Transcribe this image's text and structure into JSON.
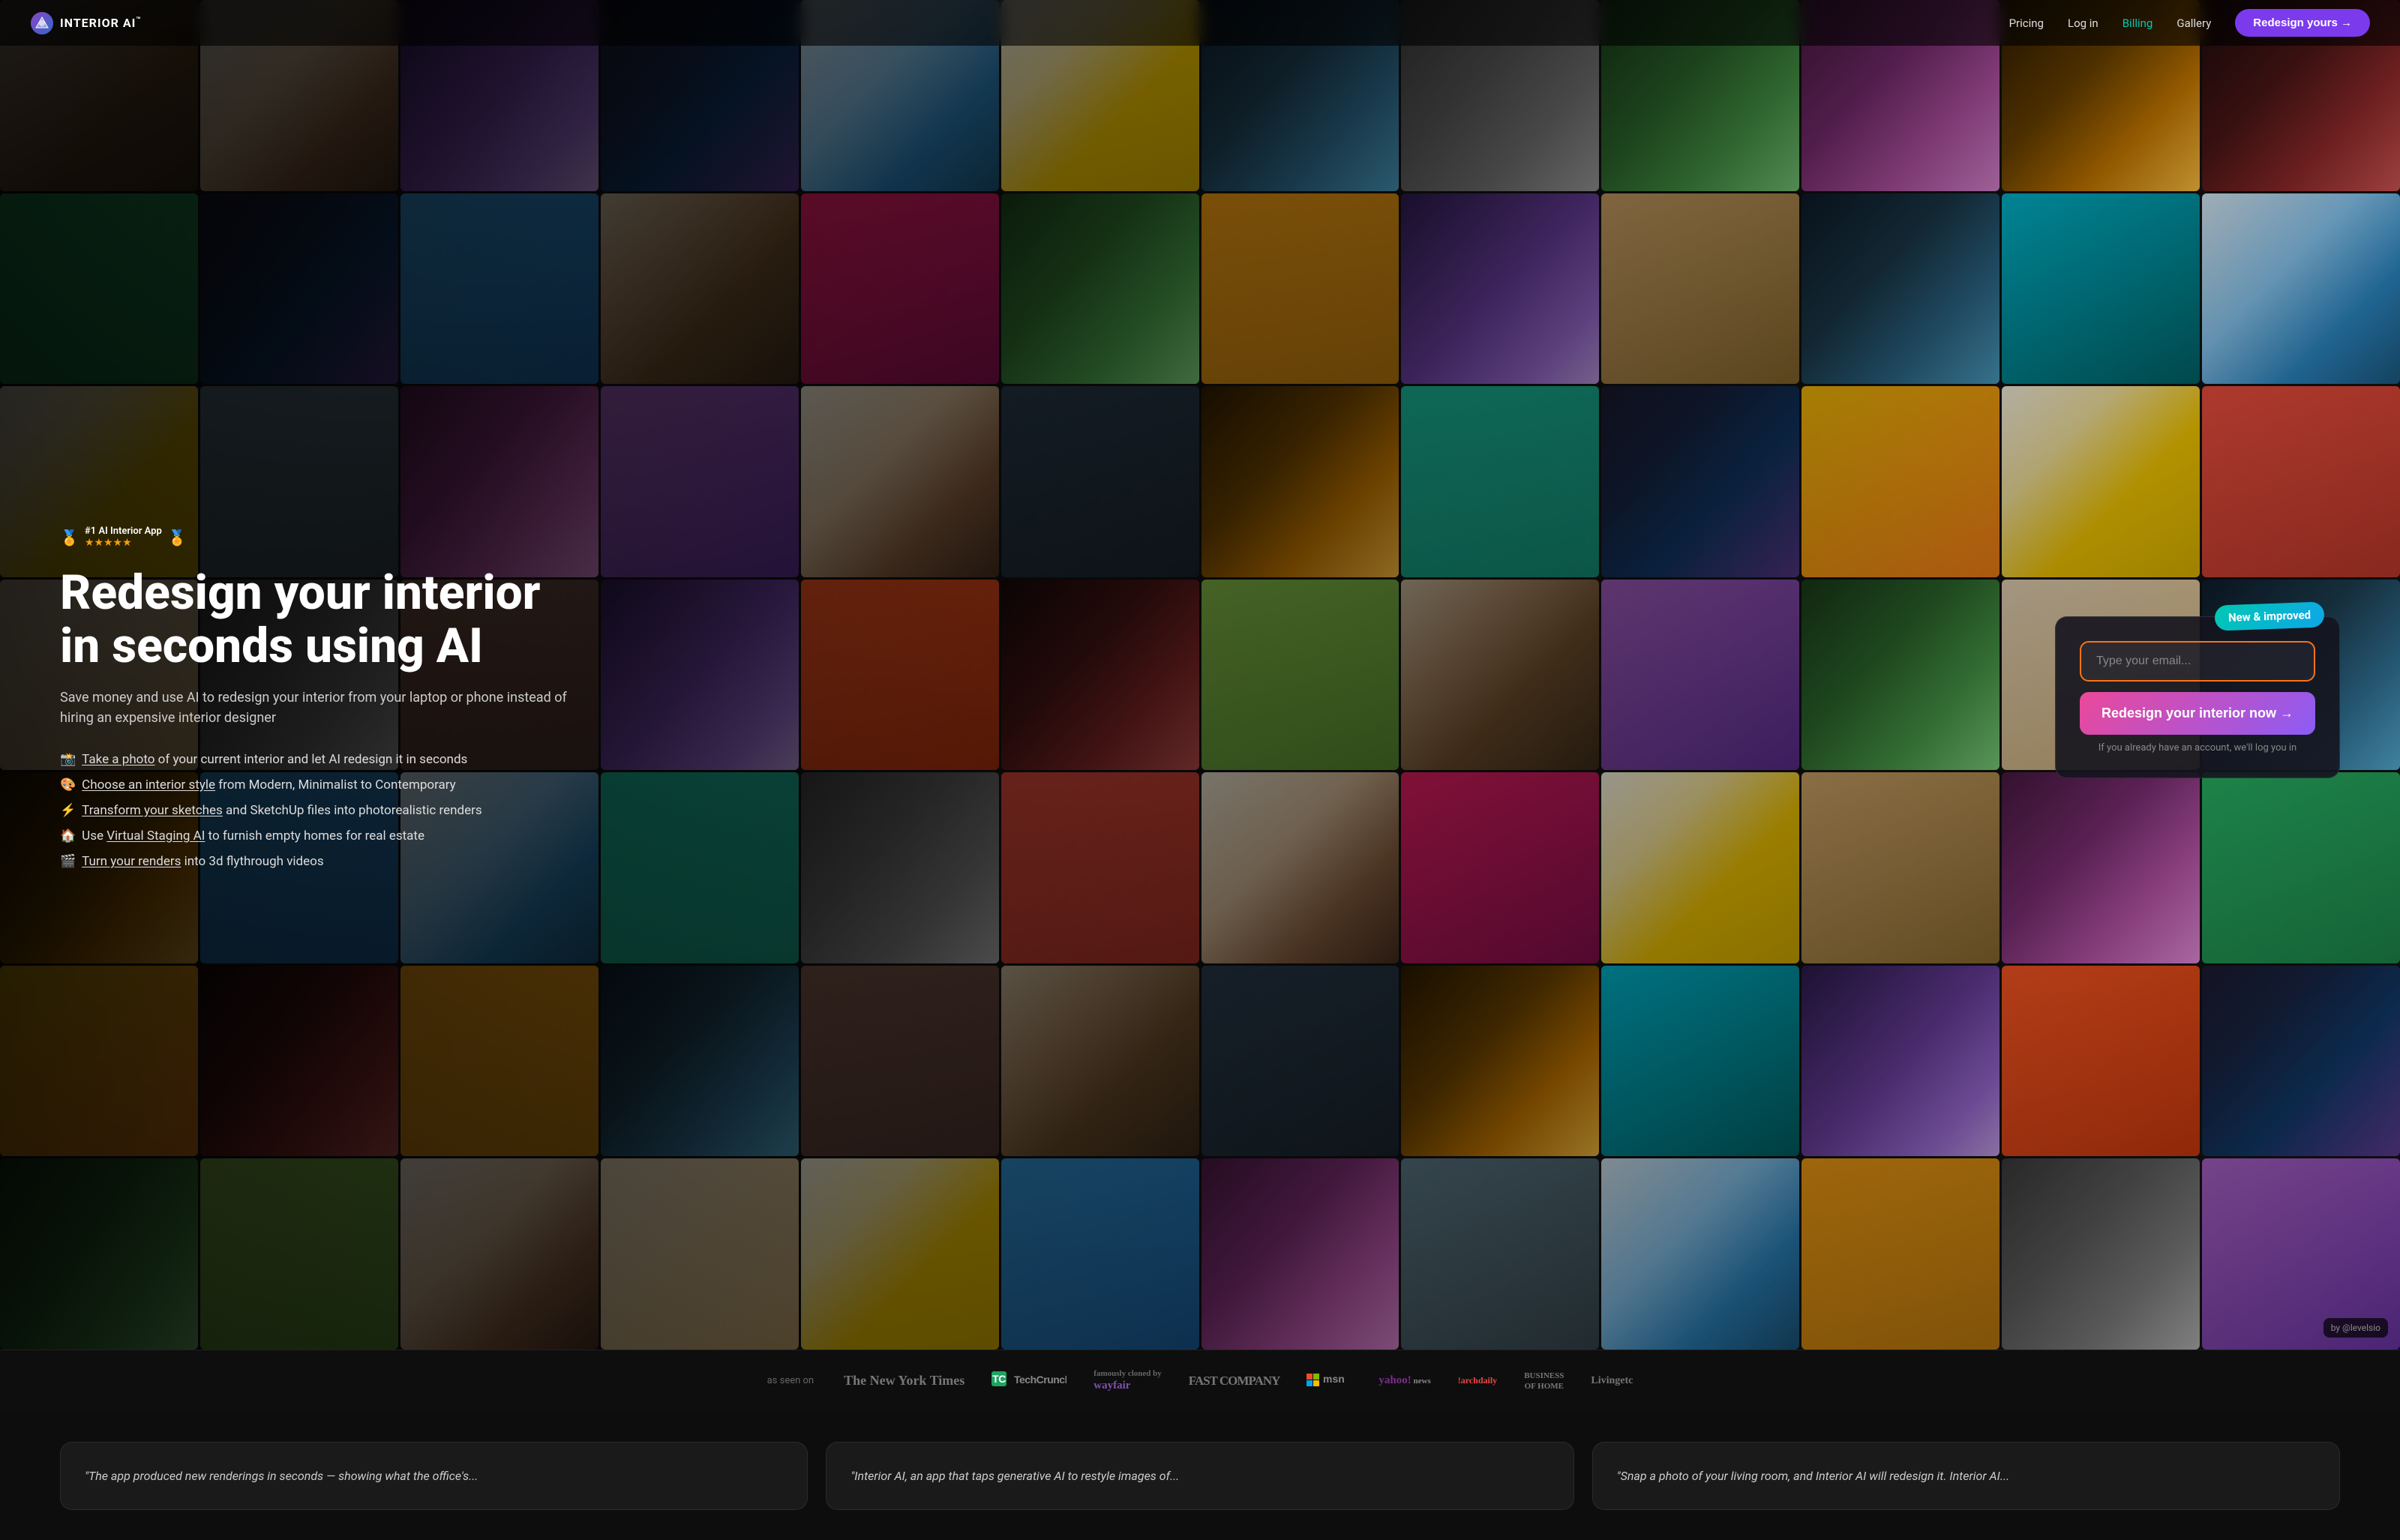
{
  "nav": {
    "logo_text": "INTERIOR AI",
    "logo_tm": "™",
    "links": [
      {
        "label": "Pricing",
        "id": "pricing"
      },
      {
        "label": "Log in",
        "id": "login"
      },
      {
        "label": "Billing",
        "id": "billing",
        "accent": true
      },
      {
        "label": "Gallery",
        "id": "gallery"
      }
    ],
    "cta_label": "Redesign yours →"
  },
  "hero": {
    "award_text": "#1 AI Interior App",
    "stars": "★★★★★",
    "title": "Redesign your interior in seconds using AI",
    "subtitle": "Save money and use AI to redesign your interior from your laptop or phone instead of hiring an expensive interior designer",
    "features": [
      {
        "emoji": "📸",
        "link_text": "Take a photo",
        "rest": " of your current interior and let AI redesign it in seconds"
      },
      {
        "emoji": "🎨",
        "link_text": "Choose an interior style",
        "rest": " from Modern, Minimalist to Contemporary"
      },
      {
        "emoji": "⚡",
        "link_text": "Transform your sketches",
        "rest": " and SketchUp files into photorealistic renders"
      },
      {
        "emoji": "🏠",
        "link_text": "Virtual Staging AI",
        "prefix": "Use ",
        "rest": " to furnish empty homes for real estate"
      },
      {
        "emoji": "🎬",
        "link_text": "Turn your renders",
        "rest": " into 3d flythrough videos"
      }
    ],
    "new_badge": "New & improved",
    "email_placeholder": "Type your email...",
    "cta_button": "Redesign your interior now →",
    "cta_note": "If you already have an account, we'll log you in"
  },
  "press": {
    "label": "as seen on",
    "logos": [
      {
        "text": "The New York Times",
        "class": "nyt"
      },
      {
        "text": "TechCrunch",
        "class": "tc"
      },
      {
        "text": "famously cloned by\nwayfair",
        "class": "wayfair"
      },
      {
        "text": "FAST COMPANY",
        "class": "fast"
      },
      {
        "text": "msn",
        "class": "msn"
      },
      {
        "text": "yahoo! news",
        "class": "yahoo"
      },
      {
        "text": "!archdaily",
        "class": "arch"
      },
      {
        "text": "BUSINESS\nOF HOME",
        "class": "boh"
      },
      {
        "text": "Livingetc",
        "class": "living"
      }
    ]
  },
  "testimonials": [
    {
      "text": "\"The app produced new renderings in seconds — showing what the office's..."
    },
    {
      "text": "\"Interior AI, an app that taps generative AI to restyle images of..."
    },
    {
      "text": "\"Snap a photo of your living room, and Interior AI will redesign it. Interior AI..."
    }
  ],
  "by": "by @levelsio",
  "colors": {
    "accent_purple": "#7c3aed",
    "accent_teal": "#00c9b1",
    "accent_orange": "#f97316",
    "cta_gradient_start": "#ec4899",
    "cta_gradient_end": "#8b5cf6"
  }
}
